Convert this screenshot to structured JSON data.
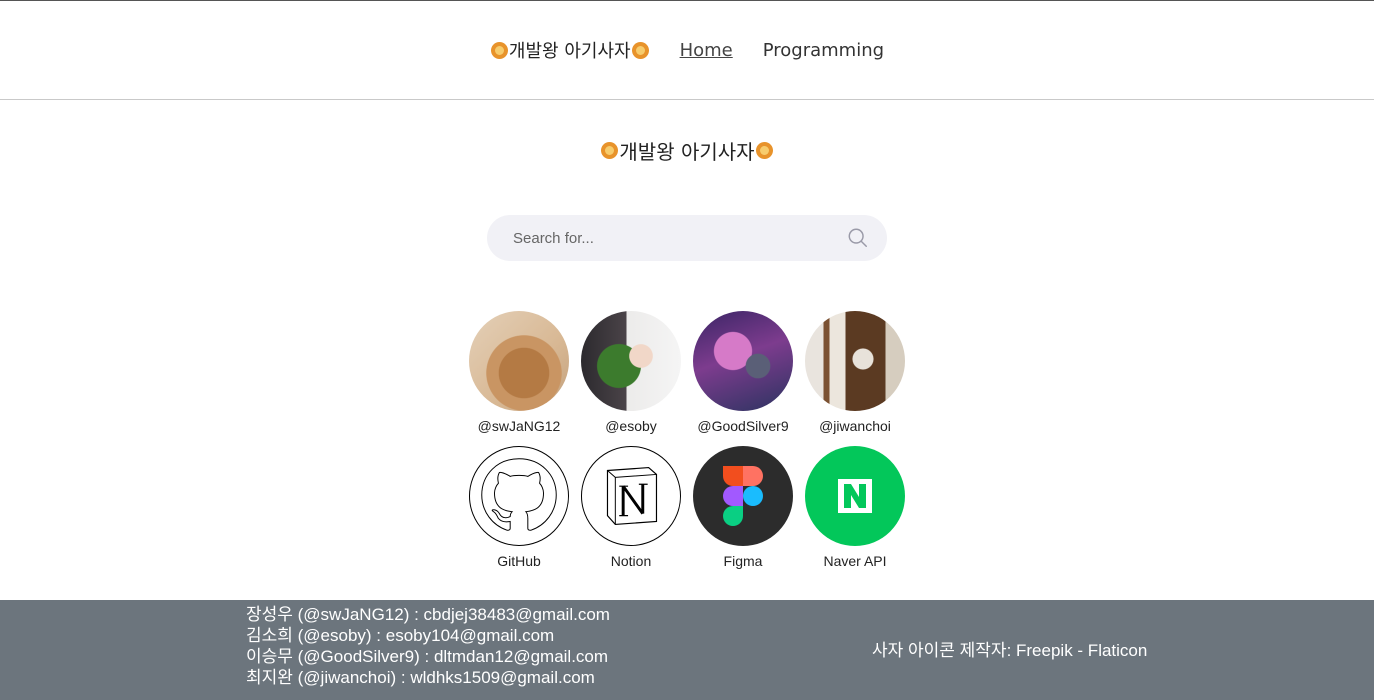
{
  "header": {
    "brand": "개발왕 아기사자",
    "nav": [
      {
        "label": "Home",
        "active": true
      },
      {
        "label": "Programming",
        "active": false
      }
    ]
  },
  "main": {
    "title": "개발왕 아기사자"
  },
  "search": {
    "placeholder": "Search for..."
  },
  "members": [
    {
      "handle": "@swJaNG12",
      "icon": "cat-avatar"
    },
    {
      "handle": "@esoby",
      "icon": "person-avatar"
    },
    {
      "handle": "@GoodSilver9",
      "icon": "robot-avatar"
    },
    {
      "handle": "@jiwanchoi",
      "icon": "cat-avatar"
    }
  ],
  "tools": [
    {
      "label": "GitHub",
      "icon": "github-icon"
    },
    {
      "label": "Notion",
      "icon": "notion-icon"
    },
    {
      "label": "Figma",
      "icon": "figma-icon"
    },
    {
      "label": "Naver API",
      "icon": "naver-icon"
    }
  ],
  "footer": {
    "contacts": [
      "장성우 (@swJaNG12) : cbdjej38483@gmail.com",
      "김소희 (@esoby) : esoby104@gmail.com",
      "이승무 (@GoodSilver9) : dltmdan12@gmail.com",
      "최지완 (@jiwanchoi) : wldhks1509@gmail.com"
    ],
    "credit": "사자 아이콘 제작자: Freepik - Flaticon"
  },
  "colors": {
    "footer_bg": "#6c757d",
    "search_bg": "#f1f1f6",
    "naver_green": "#03c75a",
    "figma_bg": "#2c2c2c"
  }
}
